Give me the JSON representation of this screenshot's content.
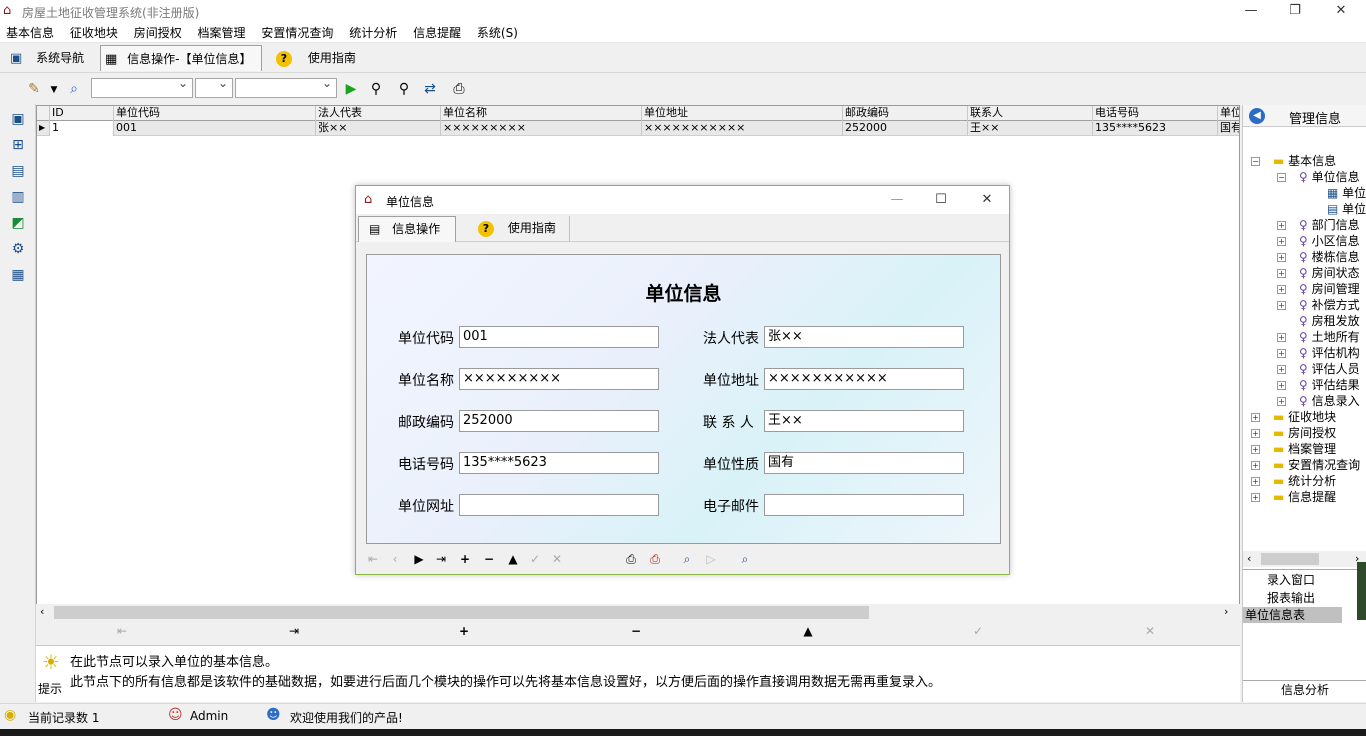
{
  "window": {
    "title": "房屋土地征收管理系统(非注册版)"
  },
  "menu": [
    "基本信息",
    "征收地块",
    "房间授权",
    "档案管理",
    "安置情况查询",
    "统计分析",
    "信息提醒",
    "系统(S)"
  ],
  "tabs": {
    "nav": "系统导航",
    "current": "信息操作-【单位信息】",
    "guide": "使用指南"
  },
  "grid": {
    "columns": [
      "ID",
      "单位代码",
      "法人代表",
      "单位名称",
      "单位地址",
      "邮政编码",
      "联系人",
      "电话号码",
      "单位"
    ],
    "rows": [
      [
        "1",
        "001",
        "张××",
        "×××××××××",
        "×××××××××××",
        "252000",
        "王××",
        "135****5623",
        "国有"
      ]
    ]
  },
  "right_panel": {
    "title": "管理信息",
    "tree": [
      "基本信息",
      "单位信息",
      "单位",
      "单位",
      "部门信息",
      "小区信息",
      "楼栋信息",
      "房间状态",
      "房间管理",
      "补偿方式",
      "房租发放",
      "土地所有",
      "评估机构",
      "评估人员",
      "评估结果",
      "信息录入",
      "征收地块",
      "房间授权",
      "档案管理",
      "安置情况查询",
      "统计分析",
      "信息提醒"
    ],
    "items": [
      "录入窗口",
      "报表输出",
      "单位信息表"
    ],
    "footer": "信息分析"
  },
  "hint": {
    "line1": "在此节点可以录入单位的基本信息。",
    "line2": "此节点下的所有信息都是该软件的基础数据，如要进行后面几个模块的操作可以先将基本信息设置好，以方便后面的操作直接调用数据无需再重复录入。",
    "label": "提示"
  },
  "status": {
    "records": "当前记录数 1",
    "user": "Admin",
    "welcome": "欢迎使用我们的产品!"
  },
  "dialog": {
    "title": "单位信息",
    "tab1": "信息操作",
    "tab2": "使用指南",
    "heading": "单位信息",
    "fields": {
      "code": {
        "label": "单位代码",
        "value": "001"
      },
      "legal": {
        "label": "法人代表",
        "value": "张××"
      },
      "name": {
        "label": "单位名称",
        "value": "×××××××××"
      },
      "address": {
        "label": "单位地址",
        "value": "×××××××××××"
      },
      "zip": {
        "label": "邮政编码",
        "value": "252000"
      },
      "contact": {
        "label": "联 系 人",
        "value": "王××"
      },
      "phone": {
        "label": "电话号码",
        "value": "135****5623"
      },
      "nature": {
        "label": "单位性质",
        "value": "国有"
      },
      "web": {
        "label": "单位网址",
        "value": ""
      },
      "email": {
        "label": "电子邮件",
        "value": ""
      }
    }
  }
}
